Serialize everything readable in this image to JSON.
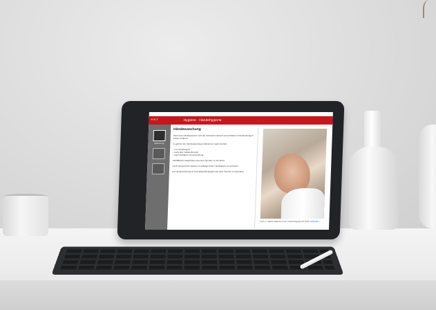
{
  "tablet_screen": {
    "app_logo": "≡·S·T",
    "title": "Hygiene · Händehygiene",
    "nav_items": [
      {
        "label": "Waschung"
      },
      {
        "label": ""
      },
      {
        "label": ""
      }
    ],
    "heading": "Händewaschung",
    "paragraphs": [
      "Durch das Händewaschen wird die Keimzahl reduziert und sichtbare Verschmutzungen werden entfernt.",
      "Es gibt für die Händewaschung mindestens 3 gute Gründe:"
    ],
    "bullets": [
      "– vor Dienstbeginn",
      "– nach dem Toilettenbesuch",
      "– nach sichtbarer Verschmutzung"
    ],
    "paragraphs_after": [
      "Handflächen Waschlotion aus dem Spender zu benutzen.",
      "Leicht temperiertes Wasser ist anfangend der Handwäsche zu benutzen.",
      "Zur Händetrocknung ist Einmalhandtuchpapier aus dem Spender zu benutzen."
    ],
    "photo_caption": "Foto 4: Hände Waschen und Trockenlegung mit Seife",
    "photo_caption_link": "schließen ›"
  },
  "colors": {
    "title_bar": "#c8161d",
    "side_nav": "#6e6e6e"
  }
}
